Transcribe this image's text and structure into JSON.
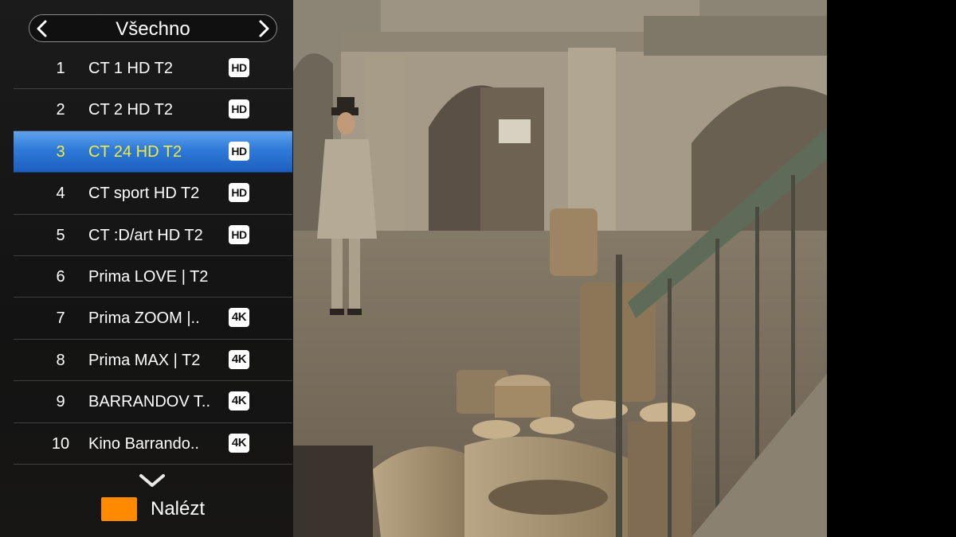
{
  "header": {
    "group_name": "Všechno",
    "prev_icon": "chevron-left-icon",
    "next_icon": "chevron-right-icon"
  },
  "channels": [
    {
      "number": "1",
      "name": "CT 1 HD T2",
      "badge": "HD"
    },
    {
      "number": "2",
      "name": "CT 2 HD T2",
      "badge": "HD"
    },
    {
      "number": "3",
      "name": "CT 24 HD T2",
      "badge": "HD"
    },
    {
      "number": "4",
      "name": "CT sport HD T2",
      "badge": "HD"
    },
    {
      "number": "5",
      "name": "CT :D/art HD T2",
      "badge": "HD"
    },
    {
      "number": "6",
      "name": "Prima LOVE | T2",
      "badge": ""
    },
    {
      "number": "7",
      "name": "Prima ZOOM |..",
      "badge": "4K"
    },
    {
      "number": "8",
      "name": "Prima MAX | T2",
      "badge": "4K"
    },
    {
      "number": "9",
      "name": "BARRANDOV T..",
      "badge": "4K"
    },
    {
      "number": "10",
      "name": "Kino Barrando..",
      "badge": "4K"
    }
  ],
  "selected_channel": "3",
  "footer": {
    "scroll_icon": "chevron-down-icon",
    "find_label": "Nalézt",
    "find_color": "#ff8a00"
  },
  "colors": {
    "selected_bg": "#2f7ad9",
    "selected_text": "#f0ec3c"
  }
}
